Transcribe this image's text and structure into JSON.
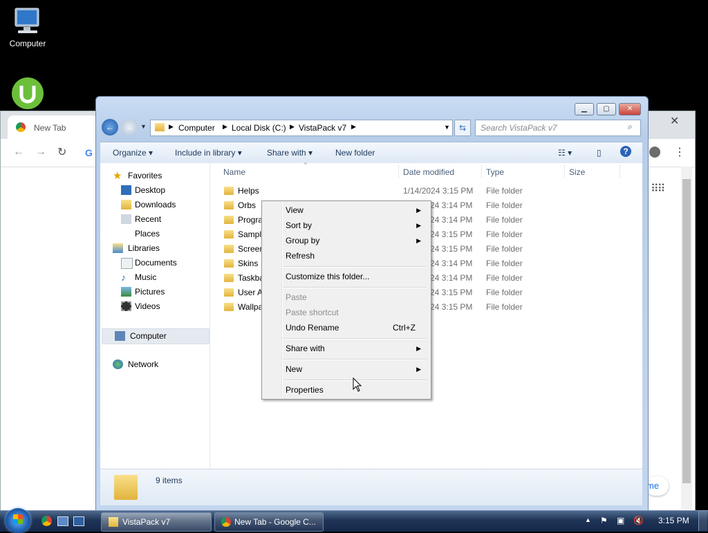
{
  "desktop": {
    "icons": [
      {
        "label": "Computer",
        "icon": "computer-icon"
      },
      {
        "label": "",
        "icon": "utorrent-icon"
      }
    ]
  },
  "chrome": {
    "tab_title": "New Tab",
    "lbl_e": "me"
  },
  "explorer": {
    "breadcrumb": [
      "Computer",
      "Local Disk (C:)",
      "VistaPack v7"
    ],
    "search_placeholder": "Search VistaPack v7",
    "commands": {
      "organize": "Organize",
      "include": "Include in library",
      "share": "Share with",
      "new_folder": "New folder"
    },
    "nav": {
      "favorites": "Favorites",
      "desktop": "Desktop",
      "downloads": "Downloads",
      "recent": "Recent Places",
      "libraries": "Libraries",
      "documents": "Documents",
      "music": "Music",
      "pictures": "Pictures",
      "videos": "Videos",
      "computer": "Computer",
      "network": "Network"
    },
    "columns": {
      "name": "Name",
      "date": "Date modified",
      "type": "Type",
      "size": "Size"
    },
    "files": [
      {
        "name": "Helps",
        "date": "1/14/2024 3:15 PM",
        "type": "File folder"
      },
      {
        "name": "Orbs",
        "date": "1/14/2024 3:14 PM",
        "type": "File folder"
      },
      {
        "name": "Progra",
        "date": "1/14/2024 3:14 PM",
        "type": "File folder"
      },
      {
        "name": "Sampl",
        "date": "1/14/2024 3:15 PM",
        "type": "File folder"
      },
      {
        "name": "Screen",
        "date": "1/14/2024 3:15 PM",
        "type": "File folder"
      },
      {
        "name": "Skins",
        "date": "1/14/2024 3:14 PM",
        "type": "File folder"
      },
      {
        "name": "Taskba",
        "date": "1/14/2024 3:14 PM",
        "type": "File folder"
      },
      {
        "name": "User A",
        "date": "1/14/2024 3:15 PM",
        "type": "File folder"
      },
      {
        "name": "Wallpa",
        "date": "1/14/2024 3:15 PM",
        "type": "File folder"
      }
    ],
    "visible_dates": [
      "1/14/2024 3:15 PM",
      "24 3:14 PM",
      "24 3:14 PM",
      "24 3:15 PM",
      "24 3:15 PM",
      "24 3:14 PM",
      "24 3:14 PM",
      "24 3:15 PM",
      "24 3:15 PM"
    ],
    "status": "9 items"
  },
  "context_menu": {
    "view": "View",
    "sort_by": "Sort by",
    "group_by": "Group by",
    "refresh": "Refresh",
    "customize": "Customize this folder...",
    "paste": "Paste",
    "paste_shortcut": "Paste shortcut",
    "undo_rename": "Undo Rename",
    "undo_shortcut": "Ctrl+Z",
    "share_with": "Share with",
    "new": "New",
    "properties": "Properties"
  },
  "taskbar": {
    "explorer_button": "VistaPack v7",
    "chrome_button": "New Tab - Google C...",
    "clock": "3:15 PM"
  },
  "colors": {
    "accent": "#1e395b",
    "taskbar": "#1e3456",
    "close_red": "#c9453a"
  }
}
